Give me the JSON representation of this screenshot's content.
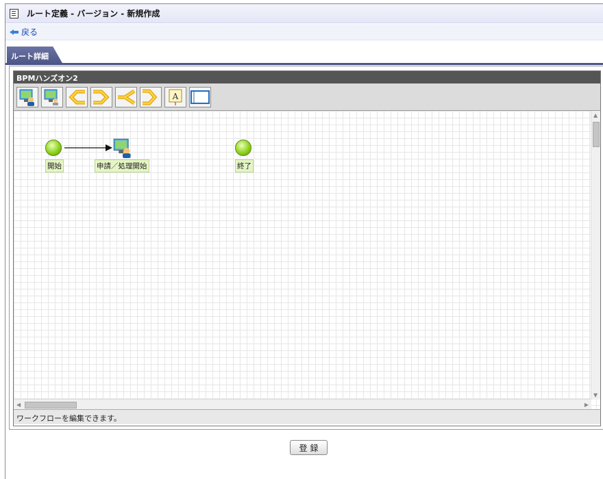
{
  "window": {
    "title": "ルート定義 - バージョン - 新規作成"
  },
  "nav": {
    "back_label": "戻る"
  },
  "tabs": [
    {
      "label": "ルート詳細",
      "active": true
    }
  ],
  "editor": {
    "title": "BPMハンズオン2",
    "toolbar": [
      {
        "icon": "process-node-icon"
      },
      {
        "icon": "approval-node-icon"
      },
      {
        "icon": "branch-start-icon"
      },
      {
        "icon": "branch-end-icon"
      },
      {
        "icon": "split-start-icon"
      },
      {
        "icon": "split-end-icon"
      },
      {
        "icon": "text-annotation-icon"
      },
      {
        "icon": "frame-icon"
      }
    ],
    "nodes": {
      "start": "開始",
      "task": "申請／処理開始",
      "end": "終了"
    },
    "status": "ワークフローを編集できます。"
  },
  "footer": {
    "register_label": "登録"
  },
  "colors": {
    "tab_bg": "#4c5587",
    "editor_title_bg": "#555555",
    "node_green": "#8fd11c",
    "label_bg": "#e6f5c6"
  }
}
